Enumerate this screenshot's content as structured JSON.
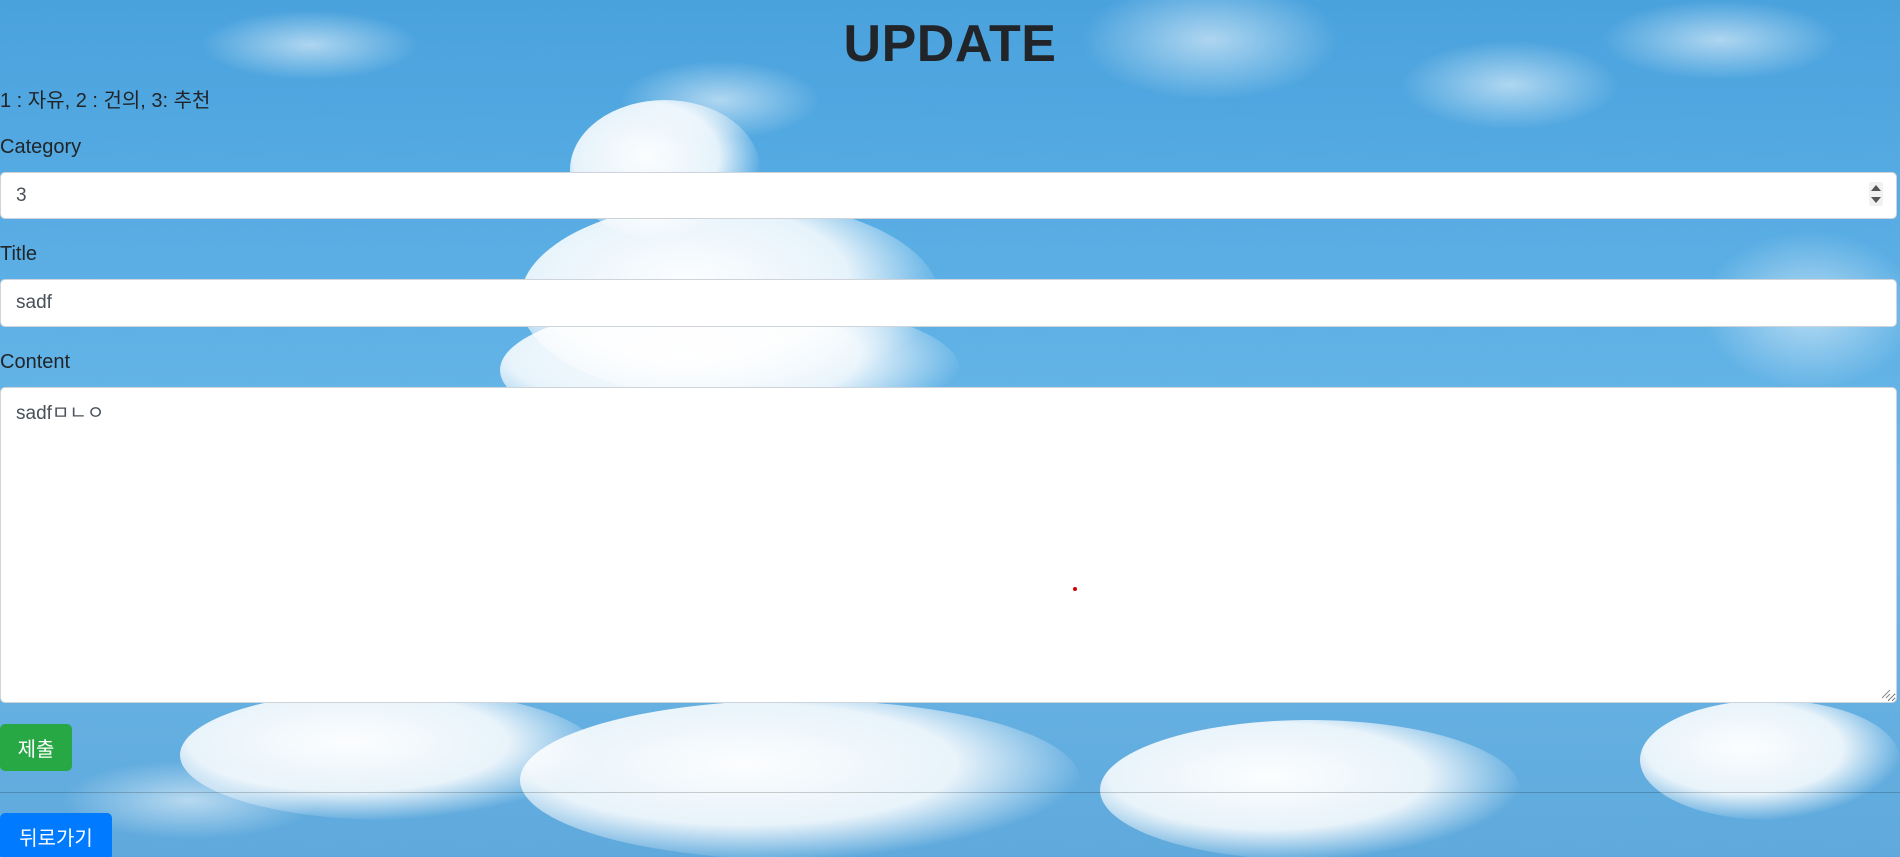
{
  "header": {
    "title": "UPDATE"
  },
  "category_legend": "1 : 자유, 2 : 건의, 3: 추천",
  "form": {
    "category": {
      "label": "Category",
      "value": "3"
    },
    "title": {
      "label": "Title",
      "value": "sadf"
    },
    "content": {
      "label": "Content",
      "value": "sadfㅁㄴㅇ"
    }
  },
  "buttons": {
    "submit_label": "제출",
    "back_label": "뒤로가기"
  },
  "colors": {
    "submit": "#28a745",
    "back": "#007bff",
    "sky": "#5aaee4"
  },
  "icons": {
    "spinner": "number-spinner-icon",
    "resize": "resize-grip-icon"
  }
}
